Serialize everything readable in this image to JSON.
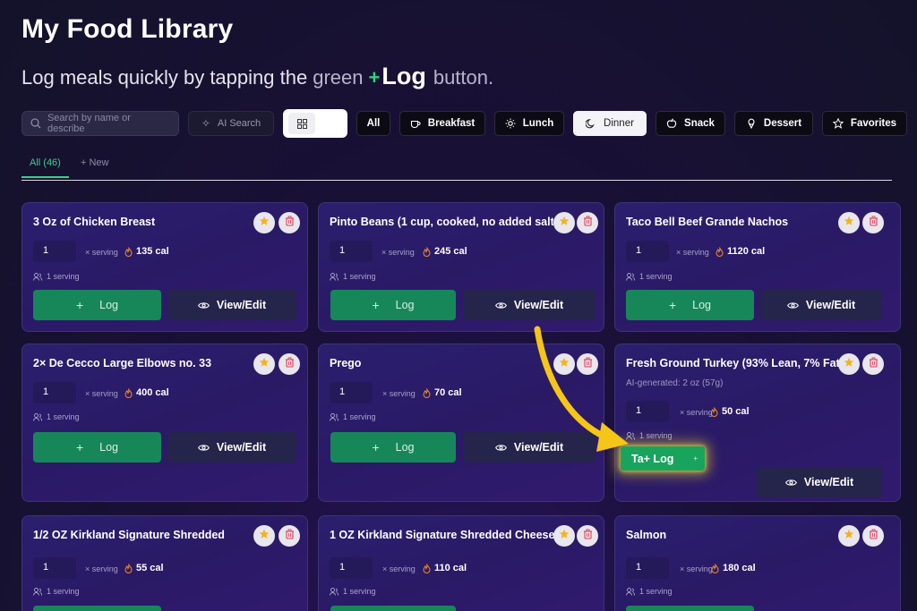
{
  "header": {
    "title": "My Food Library",
    "subtitle_prefix": "Log meals quickly by tapping the",
    "subtitle_green": "green",
    "subtitle_plus": "+",
    "subtitle_log": "Log",
    "subtitle_suffix": "button."
  },
  "toolbar": {
    "search_placeholder": "Search by name or describe",
    "ai_search_label": "AI Search",
    "filters": [
      {
        "label": "All",
        "icon": "none",
        "active": false
      },
      {
        "label": "Breakfast",
        "icon": "coffee-icon",
        "active": false
      },
      {
        "label": "Lunch",
        "icon": "sun-icon",
        "active": false
      },
      {
        "label": "Dinner",
        "icon": "moon-icon",
        "active": true
      },
      {
        "label": "Snack",
        "icon": "apple-icon",
        "active": false
      },
      {
        "label": "Dessert",
        "icon": "ice-cream-icon",
        "active": false
      },
      {
        "label": "Favorites",
        "icon": "star-icon",
        "active": false
      }
    ]
  },
  "tabs": {
    "all_label": "All (46)",
    "new_label": "+ New"
  },
  "card_common": {
    "serving_unit": "× serving",
    "servings_label": "1 serving",
    "log_label": "Log",
    "log_plus": "+",
    "view_edit_label": "View/Edit"
  },
  "cards": [
    {
      "name": "3 Oz of Chicken Breast",
      "qty": "1",
      "calories": "135 cal"
    },
    {
      "name": "Pinto Beans (1 cup, cooked, no added salt)",
      "qty": "1",
      "calories": "245 cal"
    },
    {
      "name": "Taco Bell Beef Grande Nachos",
      "qty": "1",
      "calories": "1120 cal"
    },
    {
      "name": "2× De Cecco Large Elbows no. 33",
      "qty": "1",
      "calories": "400 cal"
    },
    {
      "name": "Prego",
      "qty": "1",
      "calories": "70 cal"
    },
    {
      "name": "Fresh Ground Turkey (93% Lean, 7% Fat)",
      "qty": "1",
      "calories": "50 cal",
      "ai_note": "AI-generated: 2 oz (57g)"
    },
    {
      "name": "1/2 OZ Kirkland Signature Shredded",
      "qty": "1",
      "calories": "55 cal"
    },
    {
      "name": "1 OZ Kirkland Signature Shredded Cheese",
      "qty": "1",
      "calories": "110 cal"
    },
    {
      "name": "Salmon",
      "qty": "1",
      "calories": "180 cal"
    }
  ],
  "highlight": {
    "button_text": "Ta+ Log",
    "small_glyph": "+"
  },
  "colors": {
    "accent_green": "#17875a",
    "highlight_glow": "#f0d728",
    "arrow_yellow": "#f5c518"
  }
}
